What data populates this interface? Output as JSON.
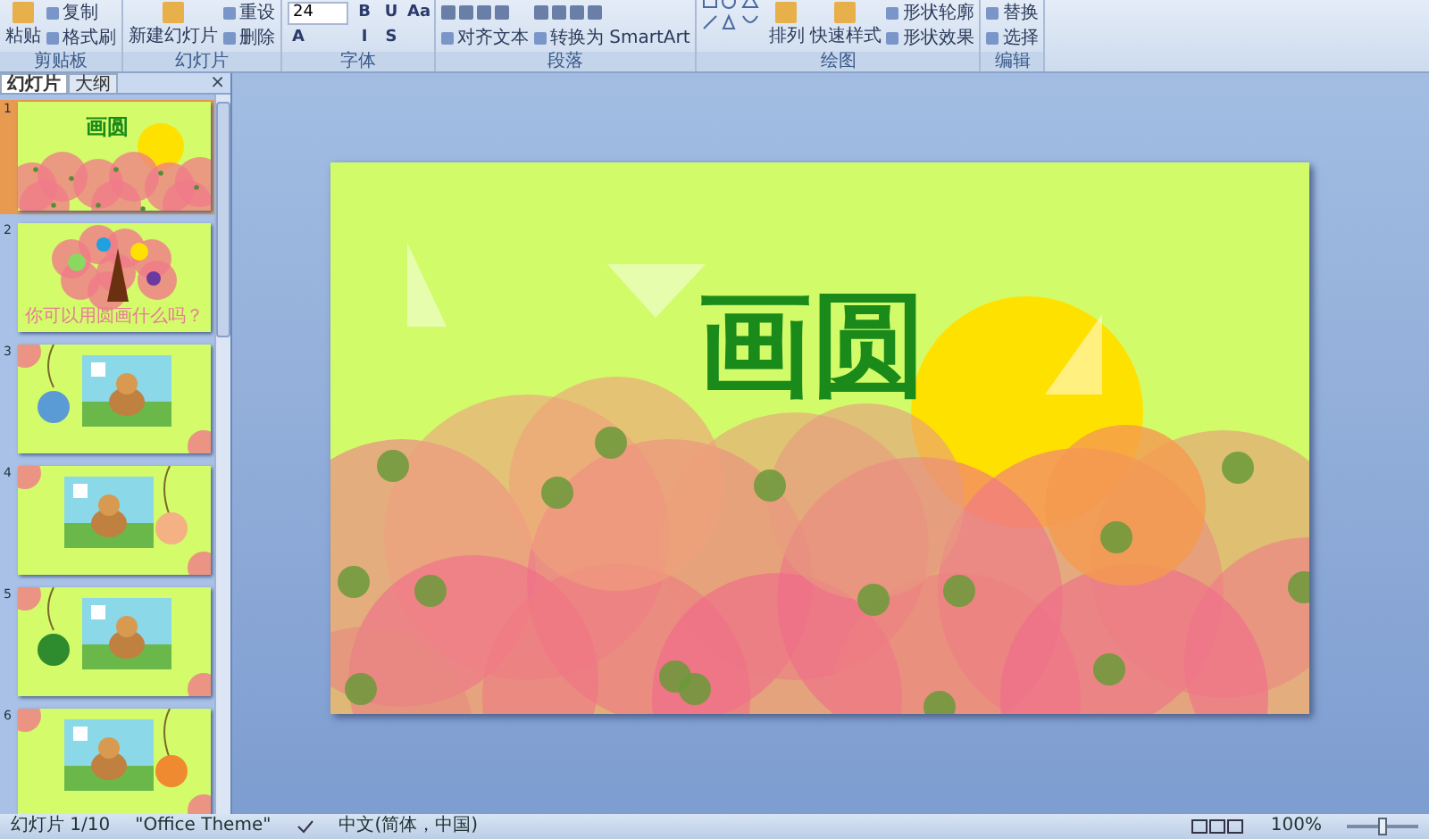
{
  "ribbon": {
    "groups": [
      {
        "label": "剪贴板",
        "items": [
          {
            "kind": "large",
            "text": "粘贴"
          },
          {
            "kind": "small",
            "text": "复制"
          },
          {
            "kind": "small",
            "text": "格式刷"
          }
        ]
      },
      {
        "label": "幻灯片",
        "items": [
          {
            "kind": "large",
            "text": "新建幻灯片"
          },
          {
            "kind": "small",
            "text": "重设"
          },
          {
            "kind": "small",
            "text": "删除"
          }
        ]
      },
      {
        "label": "字体",
        "items": [
          {
            "kind": "field",
            "text": "24"
          },
          {
            "kind": "glyph",
            "text": "A"
          },
          {
            "kind": "glyph",
            "text": "B"
          },
          {
            "kind": "glyph",
            "text": "I"
          },
          {
            "kind": "glyph",
            "text": "U"
          },
          {
            "kind": "glyph",
            "text": "S"
          },
          {
            "kind": "glyph",
            "text": "Aa"
          }
        ]
      },
      {
        "label": "段落",
        "items": [
          {
            "kind": "icons"
          },
          {
            "kind": "small",
            "text": "对齐文本"
          },
          {
            "kind": "icons"
          },
          {
            "kind": "small",
            "text": "转换为 SmartArt"
          }
        ]
      },
      {
        "label": "绘图",
        "items": [
          {
            "kind": "shapes"
          },
          {
            "kind": "large",
            "text": "排列"
          },
          {
            "kind": "large",
            "text": "快速样式"
          },
          {
            "kind": "small",
            "text": "形状轮廓"
          },
          {
            "kind": "small",
            "text": "形状效果"
          }
        ]
      },
      {
        "label": "编辑",
        "items": [
          {
            "kind": "small",
            "text": "替换"
          },
          {
            "kind": "small",
            "text": "选择"
          }
        ]
      }
    ]
  },
  "panel": {
    "tabs": [
      {
        "label": "幻灯片",
        "selected": true
      },
      {
        "label": "大纲",
        "selected": false
      }
    ],
    "close": "×",
    "slides": [
      {
        "number": "1",
        "kind": "title",
        "selected": true,
        "title": "画圆"
      },
      {
        "number": "2",
        "kind": "tree",
        "selected": false,
        "caption": "你可以用圆画什么吗？"
      },
      {
        "number": "3",
        "kind": "picture-right",
        "selected": false,
        "color": "#5b9bd5"
      },
      {
        "number": "4",
        "kind": "picture-left",
        "selected": false,
        "color": "#f4b183"
      },
      {
        "number": "5",
        "kind": "picture-right",
        "selected": false,
        "color": "#2e8b2e"
      },
      {
        "number": "6",
        "kind": "picture-left",
        "selected": false,
        "color": "#f08a30"
      }
    ]
  },
  "slide": {
    "title": "画圆"
  },
  "status_bar": {
    "slide": "幻灯片 1/10",
    "theme": "\"Office Theme\"",
    "language": "中文(简体，中国)",
    "zoom": "100%",
    "zoom_slider": {
      "level": 0.5
    }
  }
}
